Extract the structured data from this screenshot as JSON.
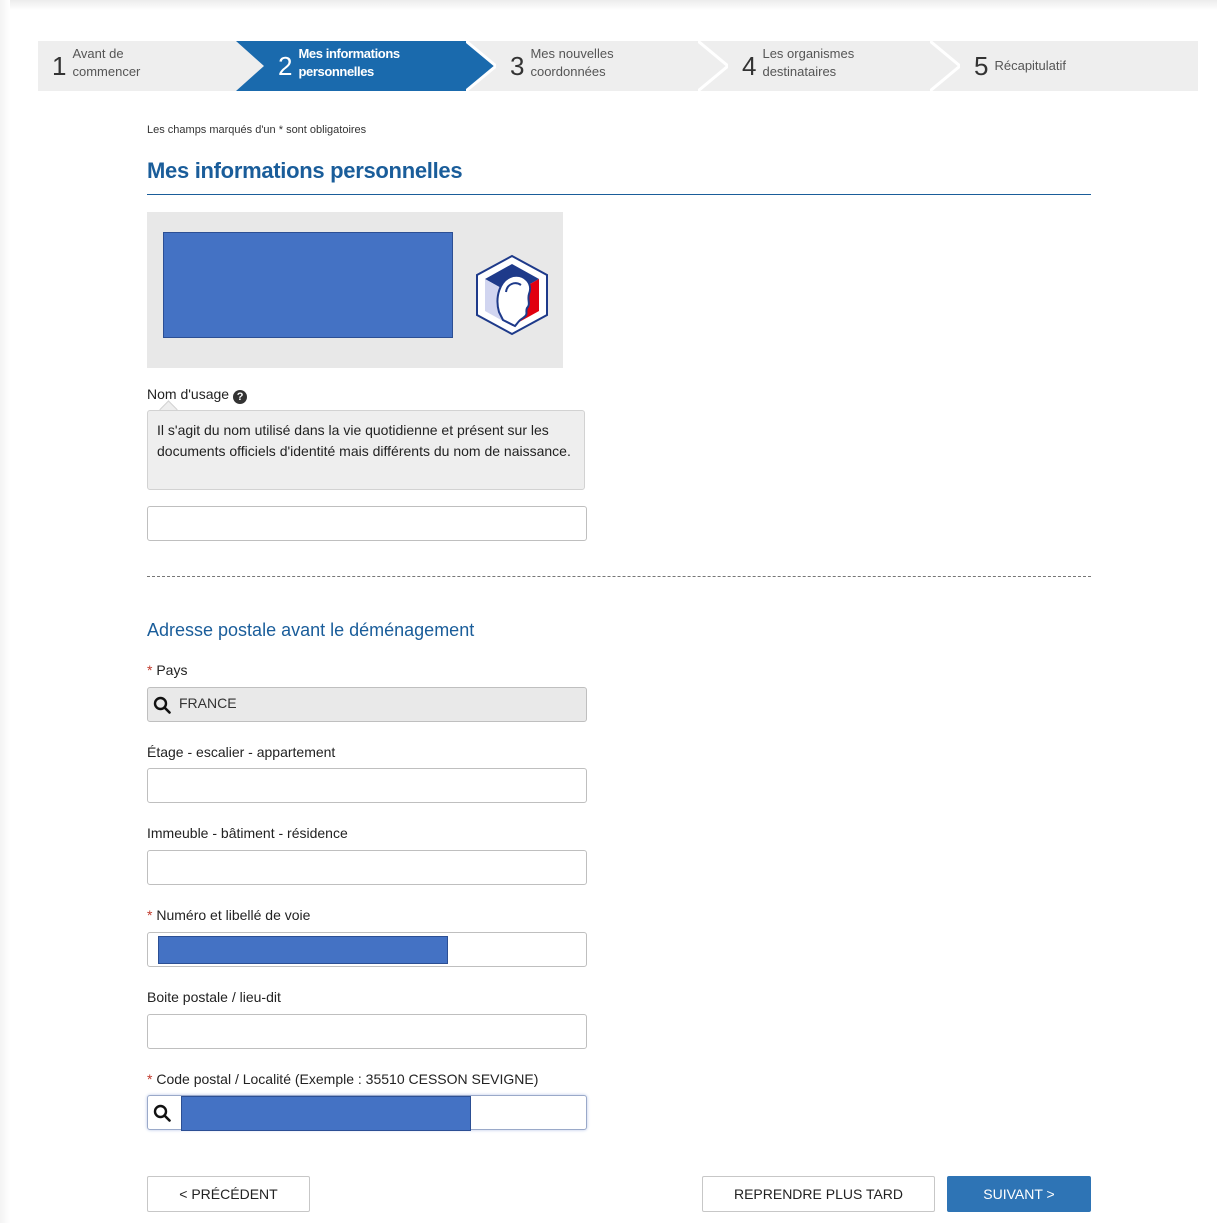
{
  "stepper": {
    "steps": [
      {
        "number": "1",
        "label": "Avant de\ncommencer"
      },
      {
        "number": "2",
        "label": "Mes informations\npersonnelles"
      },
      {
        "number": "3",
        "label": "Mes nouvelles\ncoordonnées"
      },
      {
        "number": "4",
        "label": "Les organismes\ndestinataires"
      },
      {
        "number": "5",
        "label": "Récapitulatif"
      }
    ],
    "active_step": 2,
    "active_color": "#1a6aad"
  },
  "form": {
    "required_note": "Les champs marqués d'un * sont obligatoires",
    "section_title": "Mes informations personnelles",
    "usage_name": {
      "label": "Nom d'usage",
      "help": "?",
      "tooltip": "Il s'agit du nom utilisé dans la vie quotidienne et présent sur les documents officiels d'identité mais différents du nom de naissance.",
      "value": ""
    },
    "address_title": "Adresse postale avant le déménagement",
    "required_marker": "*",
    "country": {
      "label": "Pays",
      "value": "FRANCE"
    },
    "floor": {
      "label": "Étage - escalier - appartement",
      "value": ""
    },
    "building": {
      "label": "Immeuble - bâtiment - résidence",
      "value": ""
    },
    "street": {
      "label": "Numéro et libellé de voie"
    },
    "po_box": {
      "label": "Boite postale / lieu-dit",
      "value": ""
    },
    "postal_code": {
      "label": "Code postal / Localité (Exemple : 35510 CESSON SEVIGNE)"
    }
  },
  "buttons": {
    "previous": "< PRÉCÉDENT",
    "later": "REPRENDRE PLUS TARD",
    "next": "SUIVANT >"
  },
  "colors": {
    "brand_blue": "#1a5d9a",
    "button_blue": "#2e74b5",
    "redaction": "#4472c4",
    "required": "#c0392b"
  }
}
